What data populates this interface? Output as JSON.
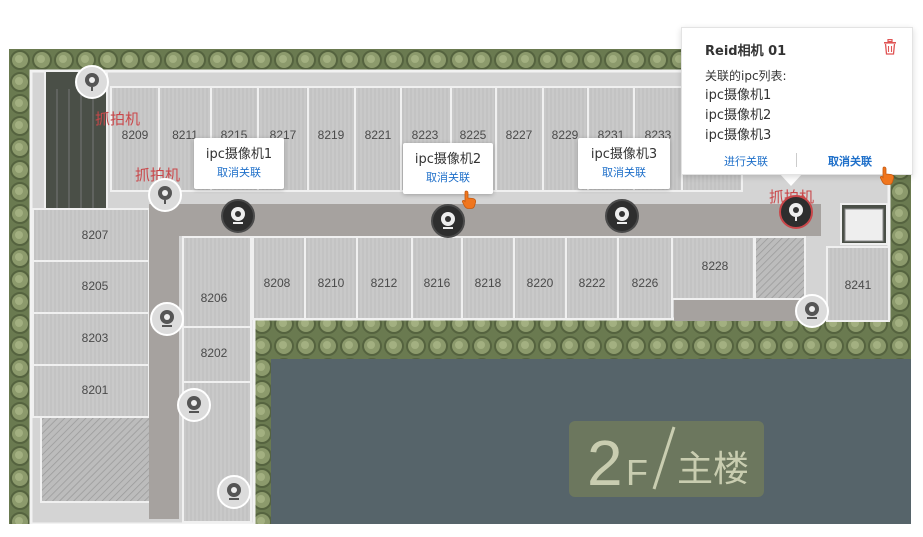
{
  "floor": {
    "number": "2",
    "unit": "F",
    "building": "主楼"
  },
  "rooms": [
    "8209",
    "8211",
    "8215",
    "8217",
    "8219",
    "8221",
    "8223",
    "8225",
    "8227",
    "8229",
    "8231",
    "8233",
    "8207",
    "8205",
    "8203",
    "8201",
    "8208",
    "8210",
    "8212",
    "8216",
    "8218",
    "8220",
    "8222",
    "8226",
    "8228",
    "8241",
    "8206",
    "8202"
  ],
  "snap_labels": [
    "抓拍机",
    "抓拍机",
    "抓拍机"
  ],
  "cameras": [
    {
      "name": "ipc摄像机1",
      "action": "取消关联"
    },
    {
      "name": "ipc摄像机2",
      "action": "取消关联"
    },
    {
      "name": "ipc摄像机3",
      "action": "取消关联"
    }
  ],
  "popup": {
    "title": "Reid相机 01",
    "list_label": "关联的ipc列表:",
    "items": [
      "ipc摄像机1",
      "ipc摄像机2",
      "ipc摄像机3"
    ],
    "link_action": "进行关联",
    "unlink_action": "取消关联",
    "delete_icon": "trash-icon"
  },
  "colors": {
    "accent": "#1e6fc9",
    "alert": "#c9474a",
    "water": "#56646a",
    "grass": "#6f7f55",
    "pointer": "#f0761e"
  }
}
